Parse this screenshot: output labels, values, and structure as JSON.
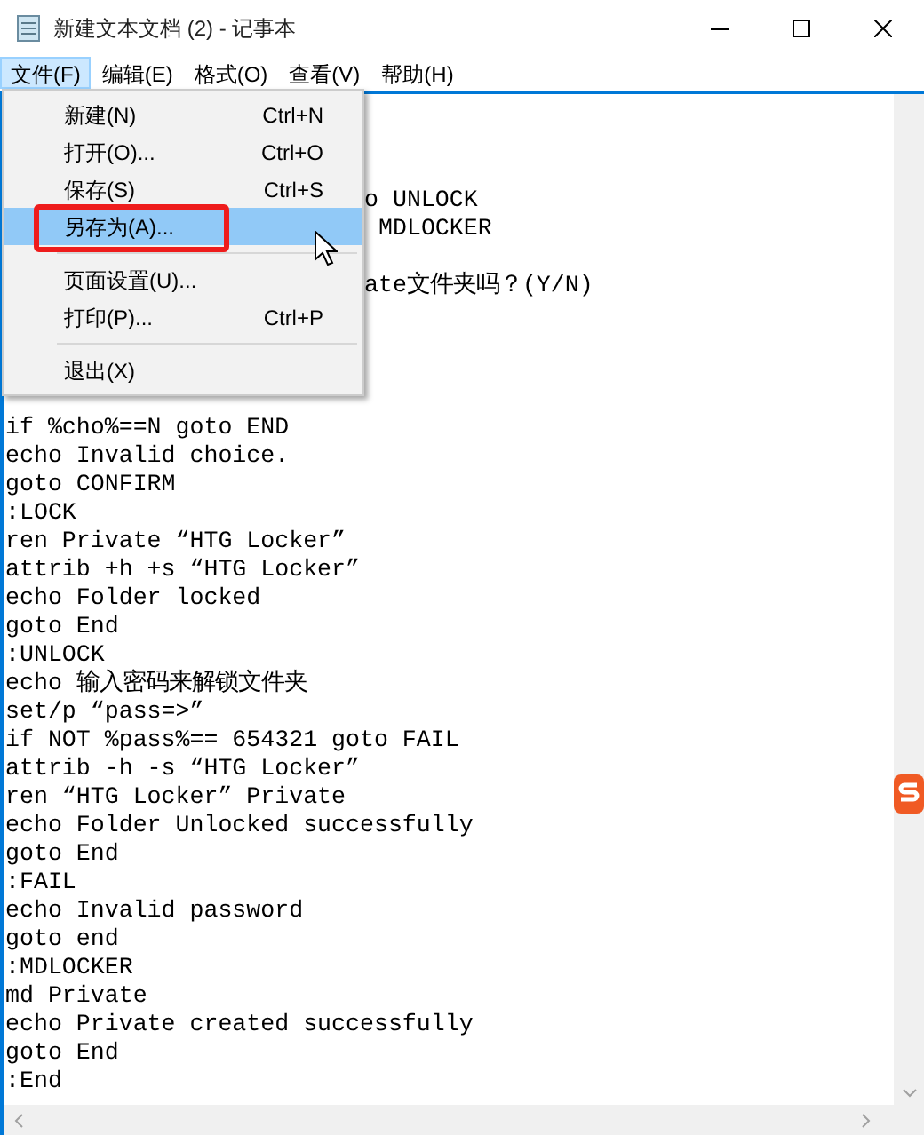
{
  "window": {
    "title": "新建文本文档 (2) - 记事本"
  },
  "menu_bar": [
    {
      "label": "文件(F)",
      "selected": true
    },
    {
      "label": "编辑(E)",
      "selected": false
    },
    {
      "label": "格式(O)",
      "selected": false
    },
    {
      "label": "查看(V)",
      "selected": false
    },
    {
      "label": "帮助(H)",
      "selected": false
    }
  ],
  "file_menu": [
    {
      "kind": "item",
      "label": "新建(N)",
      "shortcut": "Ctrl+N",
      "selected": false
    },
    {
      "kind": "item",
      "label": "打开(O)...",
      "shortcut": "Ctrl+O",
      "selected": false
    },
    {
      "kind": "item",
      "label": "保存(S)",
      "shortcut": "Ctrl+S",
      "selected": false
    },
    {
      "kind": "item",
      "label": "另存为(A)...",
      "selected": true,
      "highlighted_by_frame": true
    },
    {
      "kind": "separator"
    },
    {
      "kind": "item",
      "label": "页面设置(U)...",
      "selected": false
    },
    {
      "kind": "item",
      "label": "打印(P)...",
      "shortcut": "Ctrl+P",
      "selected": false
    },
    {
      "kind": "separator"
    },
    {
      "kind": "item",
      "label": "退出(X)",
      "selected": false
    }
  ],
  "editor": {
    "fragments": [
      "o UNLOCK",
      "MDLOCKER",
      "ate文件夹吗？(Y/N)"
    ],
    "lines": [
      "if %cho%==N goto END",
      "echo Invalid choice.",
      "goto CONFIRM",
      ":LOCK",
      "ren Private “HTG Locker”",
      "attrib +h +s “HTG Locker”",
      "echo Folder locked",
      "goto End",
      ":UNLOCK",
      "echo 输入密码来解锁文件夹",
      "set/p “pass=>”",
      "if NOT %pass%== 654321 goto FAIL",
      "attrib -h -s “HTG Locker”",
      "ren “HTG Locker” Private",
      "echo Folder Unlocked successfully",
      "goto End",
      ":FAIL",
      "echo Invalid password",
      "goto end",
      ":MDLOCKER",
      "md Private",
      "echo Private created successfully",
      "goto End",
      ":End"
    ]
  }
}
